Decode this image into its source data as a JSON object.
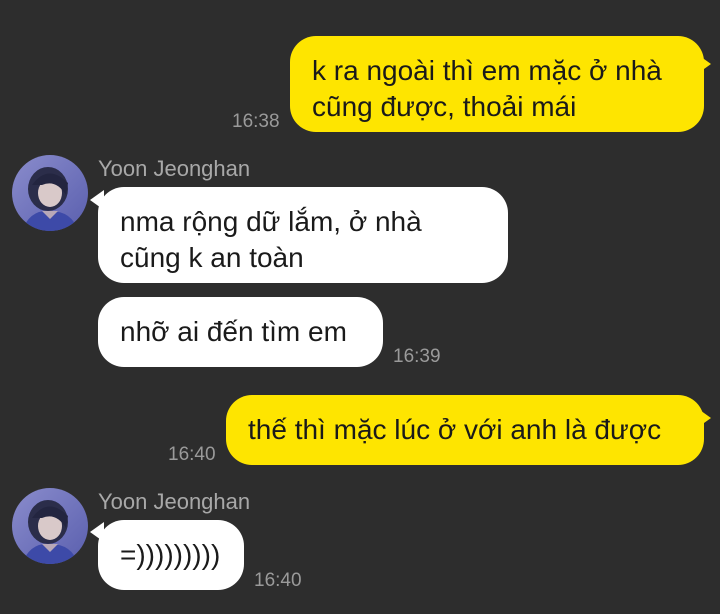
{
  "messages": [
    {
      "direction": "out",
      "lines": [
        "k ra ngoài thì em mặc ở nhà",
        "cũng được, thoải mái"
      ],
      "time": "16:38"
    },
    {
      "direction": "in",
      "sender": "Yoon Jeonghan",
      "lines": [
        "nma rộng dữ lắm, ở nhà",
        "cũng k an toàn"
      ]
    },
    {
      "direction": "in",
      "lines": [
        "nhỡ ai đến tìm em"
      ],
      "time": "16:39"
    },
    {
      "direction": "out",
      "lines": [
        "thế thì mặc lúc ở với anh là được"
      ],
      "time": "16:40"
    },
    {
      "direction": "in",
      "sender": "Yoon Jeonghan",
      "lines": [
        "=)))))))))"
      ],
      "time": "16:40"
    }
  ],
  "colors": {
    "background": "#2d2d2d",
    "outgoing_bubble": "#fee500",
    "incoming_bubble": "#ffffff",
    "timestamp": "#9a9a9a",
    "sender_name": "#a8a8a8"
  },
  "icons": {
    "avatar": "profile-photo-avatar"
  }
}
